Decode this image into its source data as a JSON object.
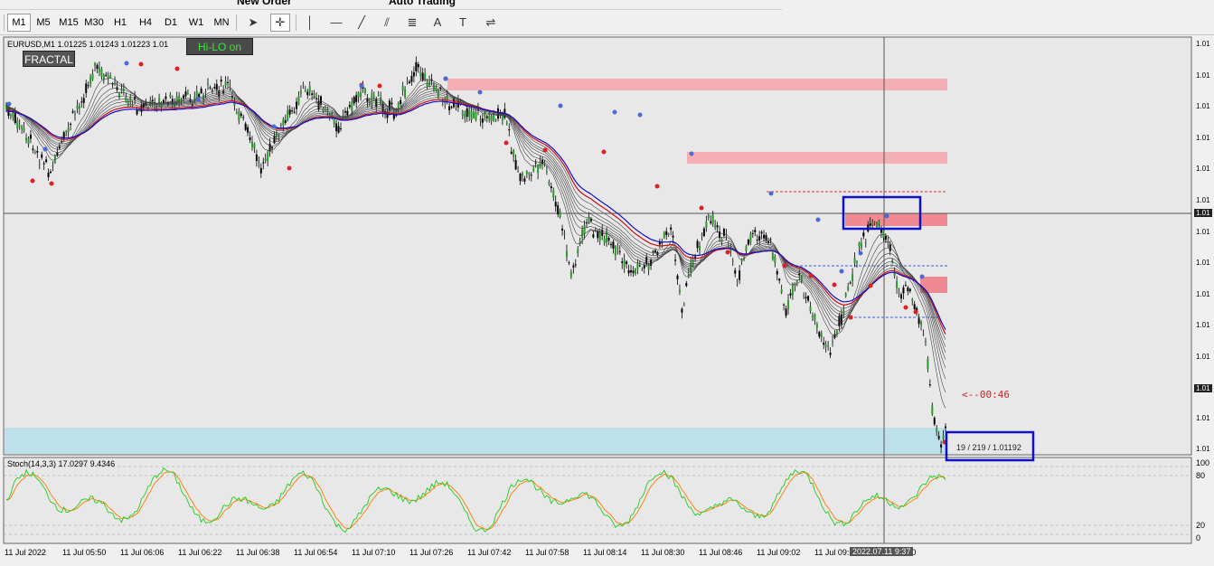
{
  "menu_toolbar": {
    "new_order_label": "New Order",
    "auto_trading_label": "Auto Trading"
  },
  "timeframes": [
    {
      "label": "M1",
      "active": true
    },
    {
      "label": "M5",
      "active": false
    },
    {
      "label": "M15",
      "active": false
    },
    {
      "label": "M30",
      "active": false
    },
    {
      "label": "H1",
      "active": false
    },
    {
      "label": "H4",
      "active": false
    },
    {
      "label": "D1",
      "active": false
    },
    {
      "label": "W1",
      "active": false
    },
    {
      "label": "MN",
      "active": false
    }
  ],
  "drawing_tools": [
    {
      "name": "cursor-icon",
      "glyph": "➤",
      "active": false
    },
    {
      "name": "crosshair-icon",
      "glyph": "✛",
      "active": true
    },
    {
      "name": "vertical-line-icon",
      "glyph": "│",
      "active": false
    },
    {
      "name": "horizontal-line-icon",
      "glyph": "—",
      "active": false
    },
    {
      "name": "trendline-icon",
      "glyph": "╱",
      "active": false
    },
    {
      "name": "channel-icon",
      "glyph": "⫽",
      "active": false
    },
    {
      "name": "fibonacci-icon",
      "glyph": "≣",
      "active": false
    },
    {
      "name": "text-icon",
      "glyph": "A",
      "active": false
    },
    {
      "name": "text-label-icon",
      "glyph": "T",
      "active": false
    },
    {
      "name": "shapes-icon",
      "glyph": "⇌",
      "active": false
    }
  ],
  "chart": {
    "symbol_info": "EURUSD,M1  1.01225 1.01243 1.01223 1.01",
    "fractal_label": "FRACTAL",
    "hilo_label": "Hi-LO on",
    "countdown": "<--00:46",
    "info_box": "19 / 219 / 1.01192",
    "price_labels": [
      "1.01",
      "1.01",
      "1.01",
      "1.01",
      "1.01",
      "1.01",
      "1.01",
      "1.01",
      "1.01",
      "1.01",
      "1.01",
      "1.01",
      "1.01",
      "1.01"
    ],
    "crosshair_price": "1.01",
    "current_price": "1.01",
    "colors": {
      "bull_candle": "#2a9a2a",
      "bear_candle": "#000000",
      "zone": "#f4aeb4",
      "support_zone": "#bde0ea",
      "box": "#1010c8"
    }
  },
  "stochastic": {
    "label": "Stoch(14,3,3) 17.0297 9.4346",
    "levels": [
      "100",
      "80",
      "20",
      "0"
    ],
    "main_color": "#22cc22",
    "signal_color": "#ff7a00"
  },
  "time_axis": {
    "labels": [
      "11 Jul 2022",
      "11 Jul 05:50",
      "11 Jul 06:06",
      "11 Jul 06:22",
      "11 Jul 06:38",
      "11 Jul 06:54",
      "11 Jul 07:10",
      "11 Jul 07:26",
      "11 Jul 07:42",
      "11 Jul 07:58",
      "11 Jul 08:14",
      "11 Jul 08:30",
      "11 Jul 08:46",
      "11 Jul 09:02",
      "11 Jul 09:",
      "11 Jul 09:50"
    ],
    "crosshair_time": "2022.07.11 9:37"
  }
}
